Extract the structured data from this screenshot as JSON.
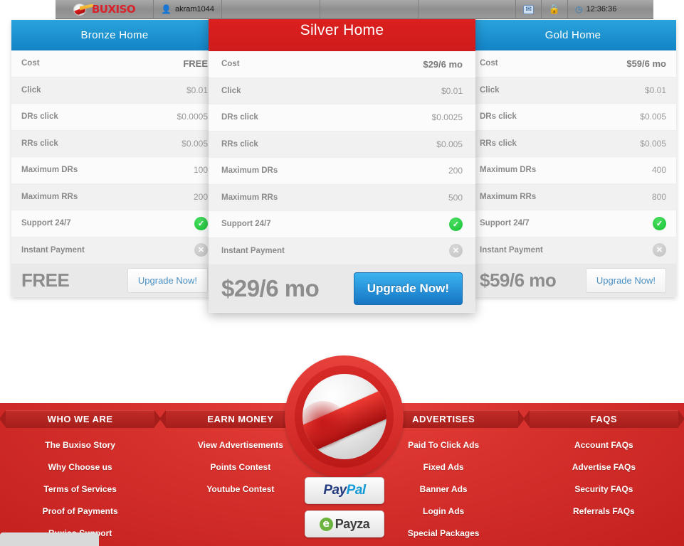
{
  "topbar": {
    "brand": "BUXISO",
    "brand_icon": "buxiso-logo-icon",
    "username": "akram1044",
    "user_icon": "user-icon",
    "mail_icon": "mail-icon",
    "lock_icon": "lock-icon",
    "clock_icon": "clock-icon",
    "time": "12:36:36"
  },
  "pricing": {
    "feature_labels": [
      "Cost",
      "Click",
      "DRs click",
      "RRs click",
      "Maximum DRs",
      "Maximum RRs",
      "Support 24/7",
      "Instant Payment"
    ],
    "yes_icon": "check-circle-icon",
    "no_icon": "x-circle-icon",
    "plans": [
      {
        "name": "Bronze Home",
        "featured": false,
        "values": [
          "FREE",
          "$0.01",
          "$0.0005",
          "$0.005",
          "100",
          "200",
          "yes",
          "no"
        ],
        "price": "FREE",
        "cta": "Upgrade Now!"
      },
      {
        "name": "Silver Home",
        "featured": true,
        "values": [
          "$29/6 mo",
          "$0.01",
          "$0.0025",
          "$0.005",
          "200",
          "500",
          "yes",
          "no"
        ],
        "price": "$29/6 mo",
        "cta": "Upgrade Now!"
      },
      {
        "name": "Gold Home",
        "featured": false,
        "values": [
          "$59/6 mo",
          "$0.01",
          "$0.005",
          "$0.005",
          "400",
          "800",
          "yes",
          "no"
        ],
        "price": "$59/6 mo",
        "cta": "Upgrade Now!"
      }
    ]
  },
  "footer": {
    "columns": [
      {
        "title": "WHO WE ARE",
        "links": [
          "The Buxiso Story",
          "Why Choose us",
          "Terms of Services",
          "Proof of Payments",
          "Buxiso Support"
        ]
      },
      {
        "title": "EARN MONEY",
        "links": [
          "View Advertisements",
          "Points Contest",
          "Youtube Contest"
        ]
      },
      {
        "title": "ADVERTISES",
        "links": [
          "Paid To Click Ads",
          "Fixed Ads",
          "Banner Ads",
          "Login Ads",
          "Special Packages"
        ]
      },
      {
        "title": "FAQS",
        "links": [
          "Account FAQs",
          "Advertise FAQs",
          "Security FAQs",
          "Referrals FAQs"
        ]
      }
    ],
    "logo_icon": "buxiso-badge-logo-icon",
    "payments": [
      {
        "name": "PayPal",
        "part_a": "Pay",
        "part_b": "Pal",
        "icon": "paypal-icon"
      },
      {
        "name": "Payza",
        "mark": "e",
        "label": "Payza",
        "icon": "payza-icon"
      }
    ]
  },
  "colors": {
    "brand_red": "#d6302c",
    "header_blue": "#1383c6",
    "cta_blue": "#1675c4",
    "yes_green": "#17c133",
    "no_gray": "#c2c2c2"
  }
}
